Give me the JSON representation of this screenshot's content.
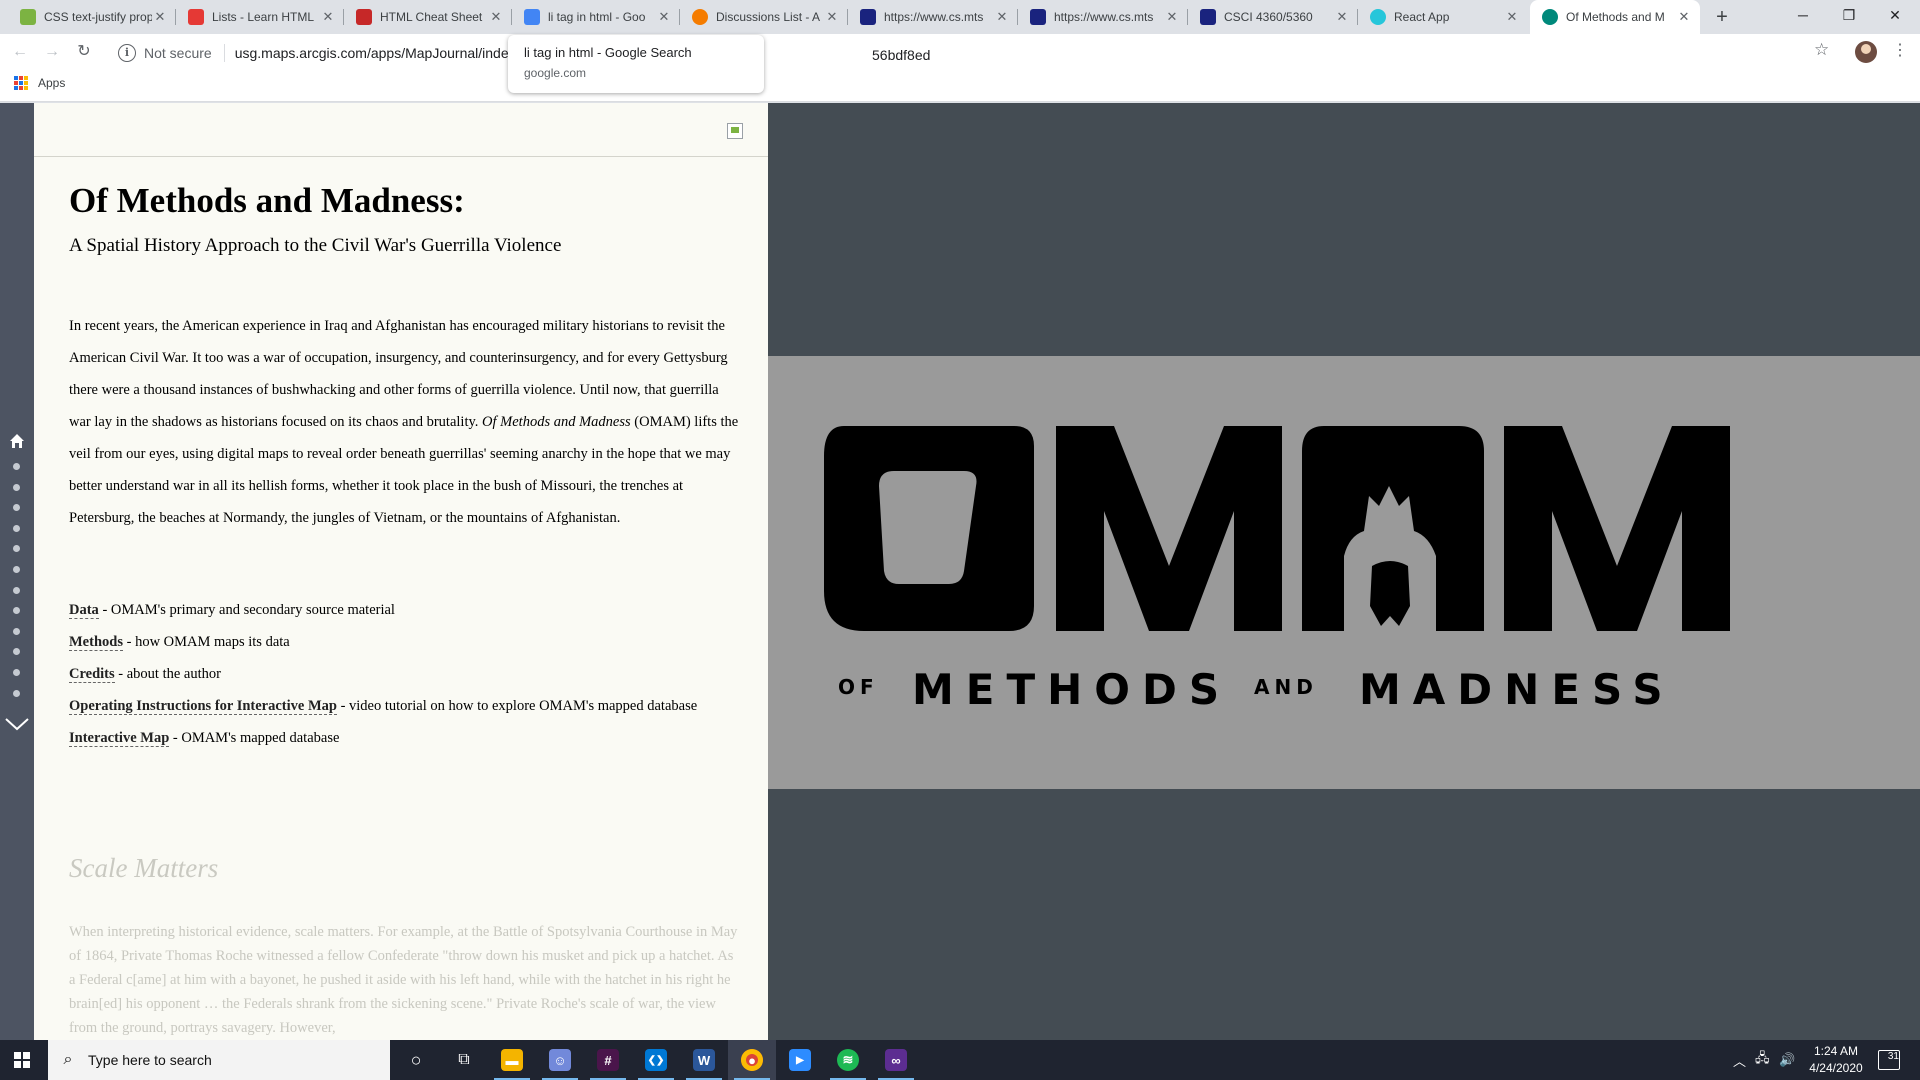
{
  "browser": {
    "tabs": [
      {
        "title": "CSS text-justify prop",
        "favicon_color": "#7cb342"
      },
      {
        "title": "Lists - Learn HTML",
        "favicon_color": "#e53935"
      },
      {
        "title": "HTML Cheat Sheet",
        "favicon_color": "#c62828"
      },
      {
        "title": "li tag in html - Goo",
        "favicon_color": "#4285f4"
      },
      {
        "title": "Discussions List - A",
        "favicon_color": "#f57c00"
      },
      {
        "title": "https://www.cs.mts",
        "favicon_color": "#1a237e"
      },
      {
        "title": "https://www.cs.mts",
        "favicon_color": "#1a237e"
      },
      {
        "title": "CSCI 4360/5360",
        "favicon_color": "#1a237e"
      },
      {
        "title": "React App",
        "favicon_color": "#26c6da"
      },
      {
        "title": "Of Methods and M",
        "favicon_color": "#00897b"
      }
    ],
    "close_glyph": "✕",
    "new_tab_glyph": "+",
    "window_controls": {
      "minimize": "─",
      "restore": "❐",
      "close": "✕"
    },
    "security_label": "Not secure",
    "url": "usg.maps.arcgis.com/apps/MapJournal/index",
    "url_tail": "56bdf8ed",
    "bookmarks": {
      "apps_label": "Apps"
    },
    "hover_card": {
      "title": "li tag in html - Google Search",
      "domain": "google.com"
    }
  },
  "page": {
    "title": "Of Methods and Madness:",
    "subtitle": "A Spatial History Approach to the Civil War's Guerrilla Violence",
    "intro_part1": "In recent years, the American experience in Iraq and Afghanistan has encouraged military historians to revisit the American Civil War. It too was a war of occupation, insurgency, and counterinsurgency, and for every Gettysburg there were a thousand instances of bushwhacking and other forms of guerrilla violence. Until now, that guerrilla war lay in the shadows as historians focused on its chaos and brutality. ",
    "intro_em": "Of Methods and Madness",
    "intro_part2": " (OMAM) lifts the veil from our eyes, using digital maps to reveal order beneath guerrillas' seeming anarchy in the hope that we may better understand war in all its hellish forms, whether it took place in the bush of Missouri, the trenches at Petersburg, the beaches at Normandy, the jungles of Vietnam, or the mountains of Afghanistan.",
    "links": [
      {
        "label": "Data",
        "desc": " - OMAM's primary and secondary source material"
      },
      {
        "label": "Methods",
        "desc": " - how OMAM maps its data"
      },
      {
        "label": "Credits",
        "desc": " - about the author"
      },
      {
        "label": "Operating Instructions for Interactive Map",
        "desc": " - video tutorial on how to explore OMAM's mapped database"
      },
      {
        "label": "Interactive Map",
        "desc": " - OMAM's mapped database"
      }
    ],
    "section2_title": "Scale Matters",
    "section2_text": "When interpreting historical evidence, scale matters. For example, at the Battle of Spotsylvania Courthouse in May of 1864, Private Thomas Roche witnessed a fellow Confederate \"throw down his musket and pick up a hatchet. As a Federal c[ame] at him with a bayonet, he pushed it aside with his left hand, while with the hatchet in his right he brain[ed] his opponent … the Federals shrank from the sickening scene.\" Private Roche's scale of war, the view from the ground, portrays savagery. However,",
    "logo": {
      "letters": "OMAM",
      "tagline_of": "OF",
      "tagline_methods": "METHODS",
      "tagline_and": "AND",
      "tagline_madness": "MADNESS"
    }
  },
  "taskbar": {
    "search_placeholder": "Type here to search",
    "apps": [
      {
        "name": "cortana",
        "glyph": "○",
        "color": "transparent"
      },
      {
        "name": "task-view",
        "glyph": "⧉",
        "color": "transparent"
      },
      {
        "name": "file-explorer",
        "glyph": "▬",
        "color": "#f4b400"
      },
      {
        "name": "discord",
        "glyph": "☺",
        "color": "#7289da"
      },
      {
        "name": "slack",
        "glyph": "#",
        "color": "#4a154b"
      },
      {
        "name": "vscode",
        "glyph": "❮❯",
        "color": "#0078d4"
      },
      {
        "name": "word",
        "glyph": "W",
        "color": "#2b579a"
      },
      {
        "name": "chrome",
        "glyph": "●",
        "color": "#db4437"
      },
      {
        "name": "zoom",
        "glyph": "▶",
        "color": "#2d8cff"
      },
      {
        "name": "spotify",
        "glyph": "≋",
        "color": "#1db954"
      },
      {
        "name": "visual-studio",
        "glyph": "∞",
        "color": "#5c2d91"
      }
    ],
    "time": "1:24 AM",
    "date": "4/24/2020",
    "notification_count": "31"
  }
}
